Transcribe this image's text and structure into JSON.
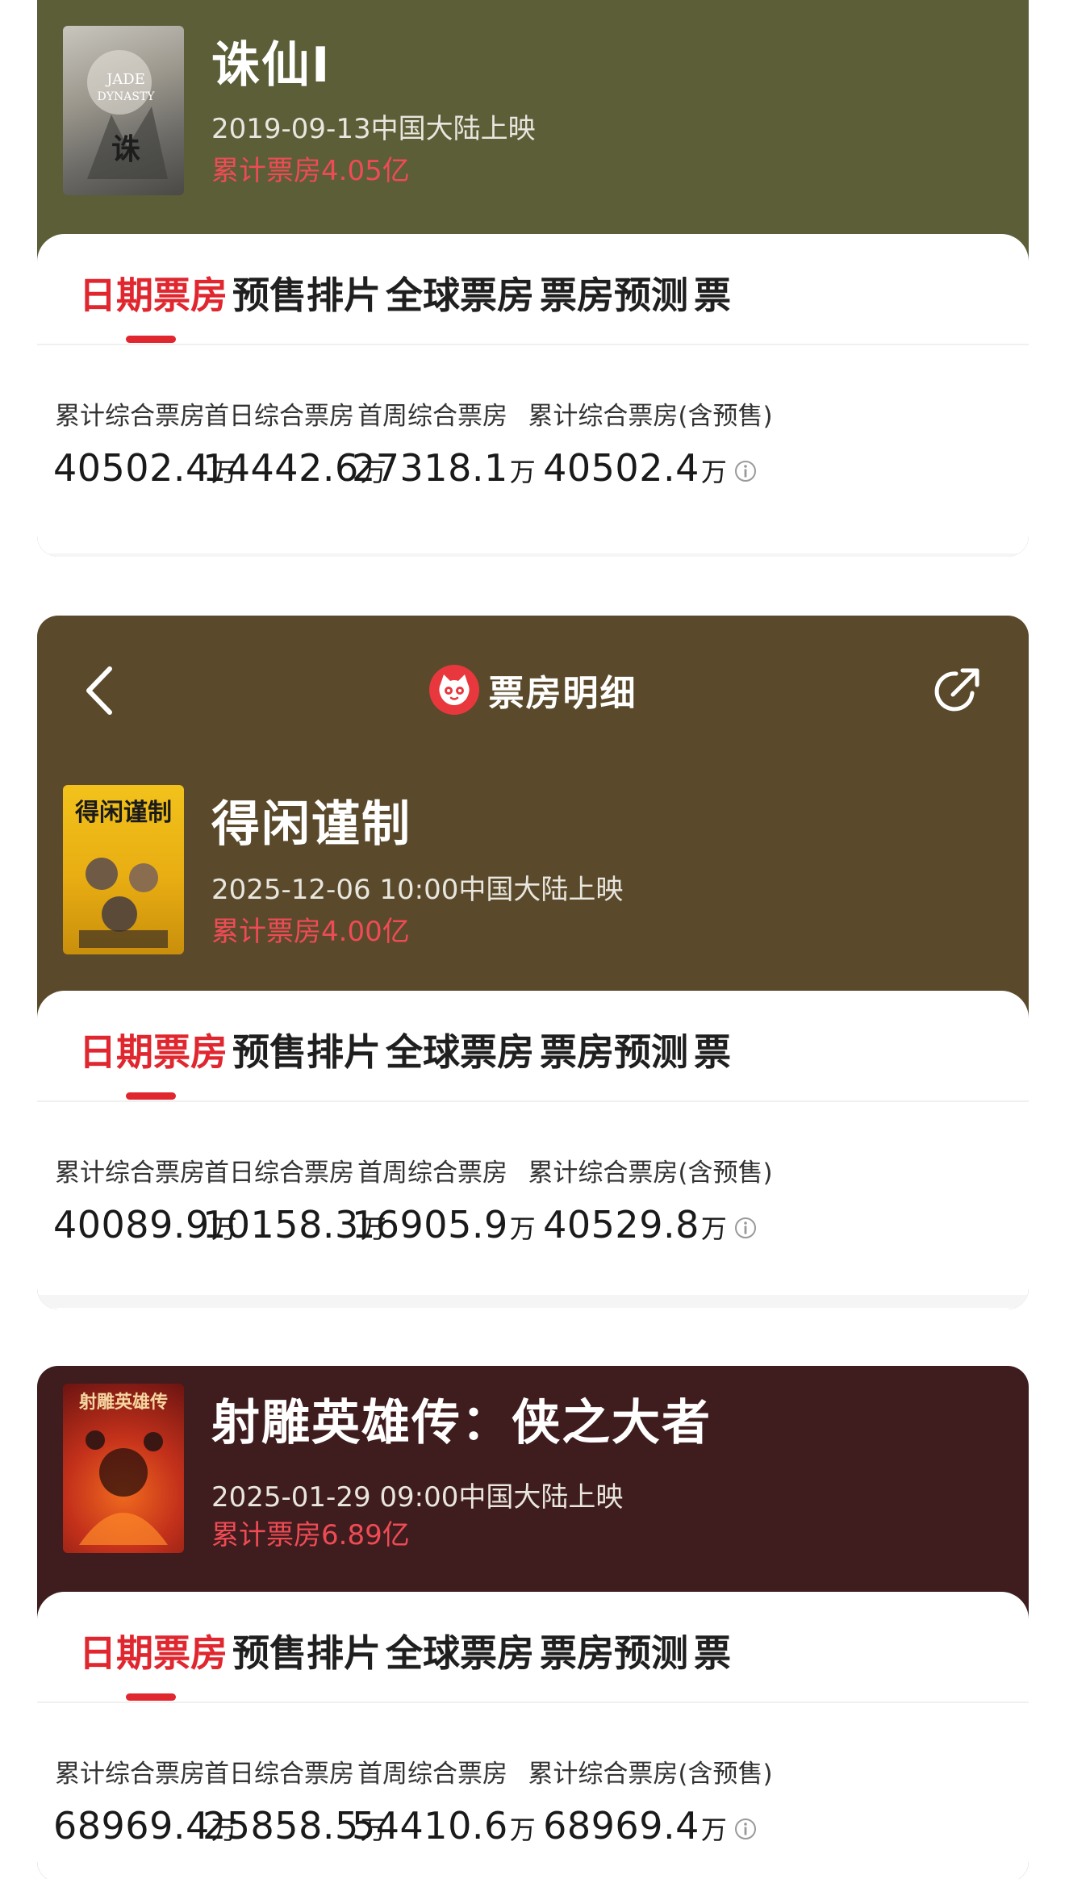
{
  "colors": {
    "accent": "#e0262e",
    "card1_bg": "#5b5e37",
    "card2_bg": "#5a4a2b",
    "card3_bg": "#3f1c1d",
    "total_text": "#ee4b55"
  },
  "navbar": {
    "title": "票房明细",
    "back_icon": "chevron-left-icon",
    "logo_icon": "maoyan-cat-logo",
    "share_icon": "share-icon"
  },
  "tabs": [
    "日期票房",
    "预售排片",
    "全球票房",
    "票房预测",
    "票"
  ],
  "stat_labels": [
    "累计综合票房",
    "首日综合票房",
    "首周综合票房",
    "累计综合票房(含预售)"
  ],
  "unit": "万",
  "movies": [
    {
      "title": "诛仙Ⅰ",
      "release": "2019-09-13中国大陆上映",
      "total": "累计票房4.05亿",
      "poster_text": "JADE DYNASTY",
      "stats": [
        "40502.4",
        "14442.6",
        "27318.1",
        "40502.4"
      ]
    },
    {
      "title": "得闲谨制",
      "release": "2025-12-06 10:00中国大陆上映",
      "total": "累计票房4.00亿",
      "poster_text": "得闲谨制",
      "stats": [
        "40089.9",
        "10158.3",
        "16905.9",
        "40529.8"
      ]
    },
    {
      "title": "射雕英雄传：侠之大者",
      "release": "2025-01-29 09:00中国大陆上映",
      "total": "累计票房6.89亿",
      "poster_text": "射雕英雄传",
      "stats": [
        "68969.4",
        "25858.5",
        "54410.6",
        "68969.4"
      ]
    }
  ]
}
